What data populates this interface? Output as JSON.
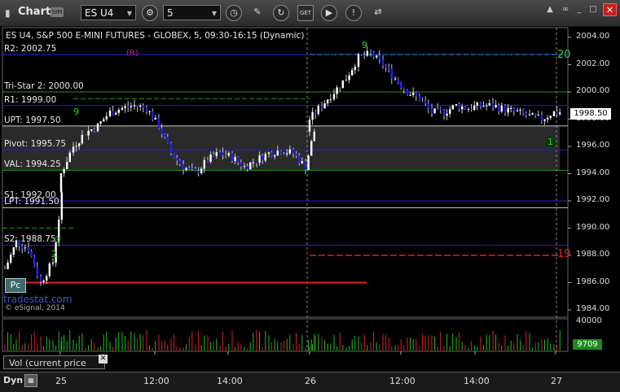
{
  "toolbar": {
    "title": "Chart",
    "symbol": "ES U4",
    "interval": "5",
    "badge": "SIM"
  },
  "chart_data": {
    "type": "candlestick",
    "title": "ES U4, S&P 500 E-MINI FUTURES - GLOBEX, 5, 09:30-16:15 (Dynamic)",
    "ylim": [
      1983.5,
      2005.0
    ],
    "y_ticks": [
      1984.0,
      1986.0,
      1988.0,
      1990.0,
      1992.0,
      1994.0,
      1996.0,
      1998.0,
      2000.0,
      2002.0,
      2004.0
    ],
    "x_ticks": [
      "25",
      "12:00",
      "14:00",
      "26",
      "12:00",
      "14:00",
      "27"
    ],
    "last_price": "1998.50",
    "levels": [
      {
        "label": "R2: 2002.75",
        "value": 2002.75,
        "color": "#2222cc"
      },
      {
        "label": "Tri-Star 2: 2000.00",
        "value": 2000.0,
        "color": "#1e9a1e"
      },
      {
        "label": "R1: 1999.00",
        "value": 1999.0,
        "color": "#2222cc"
      },
      {
        "label": "UPT: 1997.50",
        "value": 1997.5,
        "color": "#cccccc"
      },
      {
        "label": "Pivot: 1995.75",
        "value": 1995.75,
        "color": "#2222cc"
      },
      {
        "label": "VAL: 1994.25",
        "value": 1994.25,
        "color": "#1e9a1e"
      },
      {
        "label": "S1: 1992.00",
        "value": 1992.0,
        "color": "#2222cc"
      },
      {
        "label": "LPT: 1991.50",
        "value": 1991.5,
        "color": "#cccccc"
      },
      {
        "label": "S2: 1988.75",
        "value": 1988.75,
        "color": "#2222cc"
      }
    ],
    "annotations": {
      "R_marker": "(R)",
      "count_20": "20",
      "count_19": "19",
      "count_1": "1",
      "seq_9": "9",
      "seq_3": "3",
      "seq_2": "2"
    },
    "volume_axis": {
      "max_label": "40000",
      "last_volume": "9709"
    },
    "pc_label": "Pc",
    "watermark": "tradestat.com",
    "copyright": "© eSignal, 2014",
    "volume_pane_label": "Vol (current price bar)"
  },
  "footer": {
    "dyn_label": "Dyn"
  }
}
